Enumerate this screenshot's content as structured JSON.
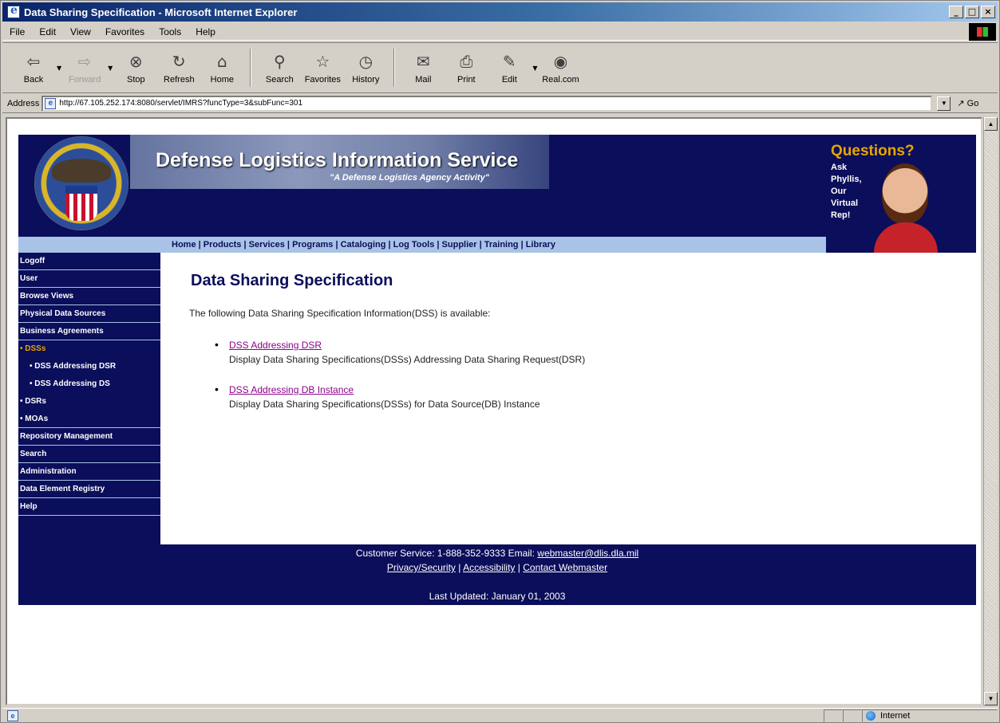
{
  "window": {
    "title": "Data Sharing Specification - Microsoft Internet Explorer",
    "controls": [
      "_",
      "□",
      "×"
    ]
  },
  "menu": [
    "File",
    "Edit",
    "View",
    "Favorites",
    "Tools",
    "Help"
  ],
  "toolbar": {
    "back": "Back",
    "forward": "Forward",
    "stop": "Stop",
    "refresh": "Refresh",
    "home": "Home",
    "search": "Search",
    "favorites": "Favorites",
    "history": "History",
    "mail": "Mail",
    "print": "Print",
    "edit": "Edit",
    "realcom": "Real.com"
  },
  "address": {
    "label": "Address",
    "url": "http://67.105.252.174:8080/servlet/IMRS?funcType=3&subFunc=301",
    "go": "Go"
  },
  "banner": {
    "site_name": "Defense Logistics Information Service",
    "tagline": "\"A Defense Logistics Agency Activity\"",
    "questions_title": "Questions?",
    "questions_text": "Ask Phyllis, Our Virtual Rep!"
  },
  "nav": {
    "links": "Home | Products | Services | Programs | Cataloging | Log Tools | Supplier | Training | Library"
  },
  "sidebar": {
    "items": [
      {
        "label": "Logoff"
      },
      {
        "label": "User"
      },
      {
        "label": "Browse Views"
      },
      {
        "label": "Physical Data Sources"
      },
      {
        "label": "Business Agreements"
      },
      {
        "label": "• DSSs"
      },
      {
        "label": "• DSS Addressing DSR"
      },
      {
        "label": "• DSS Addressing DS"
      },
      {
        "label": "• DSRs"
      },
      {
        "label": "• MOAs"
      },
      {
        "label": "Repository Management"
      },
      {
        "label": "Search"
      },
      {
        "label": "Administration"
      },
      {
        "label": "Data Element Registry"
      },
      {
        "label": "Help"
      }
    ]
  },
  "content": {
    "heading": "Data Sharing Specification",
    "intro": "The following Data Sharing Specification Information(DSS) is available:",
    "links": [
      {
        "label": "DSS Addressing DSR",
        "description": "Display Data Sharing Specifications(DSSs) Addressing Data Sharing Request(DSR)"
      },
      {
        "label": "DSS Addressing DB Instance",
        "description": "Display Data Sharing Specifications(DSSs) for Data Source(DB) Instance"
      }
    ]
  },
  "footer": {
    "customer_service": "Customer Service: 1-888-352-9333 Email:",
    "email": "webmaster@dlis.dla.mil",
    "privacy": "Privacy/Security",
    "accessibility": "Accessibility",
    "contact": "Contact Webmaster",
    "separator": "|",
    "last_updated": "Last Updated: January 01, 2003"
  },
  "status": {
    "zone": "Internet"
  },
  "colors": {
    "brand_navy": "#0b0e5a",
    "nav_strip": "#a9c3e6",
    "active_sidebar": "#e7a500",
    "visited_link": "#8b008b"
  }
}
